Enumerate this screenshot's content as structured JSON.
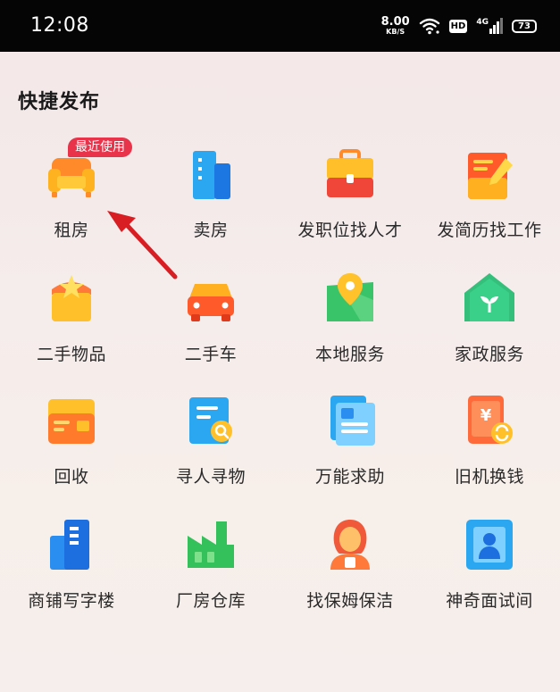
{
  "status_bar": {
    "time": "12:08",
    "net_speed_value": "8.00",
    "net_speed_unit": "KB/S",
    "hd_label": "HD",
    "network_label": "4G",
    "battery_level": "73"
  },
  "section": {
    "title": "快捷发布"
  },
  "badge": {
    "recent_label": "最近使用"
  },
  "items": [
    {
      "label": "租房",
      "icon": "sofa-icon"
    },
    {
      "label": "卖房",
      "icon": "building-icon"
    },
    {
      "label": "发职位找人才",
      "icon": "briefcase-icon"
    },
    {
      "label": "发简历找工作",
      "icon": "resume-pen-icon"
    },
    {
      "label": "二手物品",
      "icon": "gift-box-icon"
    },
    {
      "label": "二手车",
      "icon": "car-icon"
    },
    {
      "label": "本地服务",
      "icon": "map-pin-icon"
    },
    {
      "label": "家政服务",
      "icon": "house-plant-icon"
    },
    {
      "label": "回收",
      "icon": "card-icon"
    },
    {
      "label": "寻人寻物",
      "icon": "search-document-icon"
    },
    {
      "label": "万能求助",
      "icon": "document-icon"
    },
    {
      "label": "旧机换钱",
      "icon": "phone-exchange-icon"
    },
    {
      "label": "商铺写字楼",
      "icon": "office-tower-icon"
    },
    {
      "label": "厂房仓库",
      "icon": "factory-icon"
    },
    {
      "label": "找保姆保洁",
      "icon": "nanny-icon"
    },
    {
      "label": "神奇面试间",
      "icon": "interview-badge-icon"
    }
  ],
  "colors": {
    "status_bar_bg": "#050505",
    "badge_red": "#e8334a",
    "arrow_red": "#d81e22"
  }
}
